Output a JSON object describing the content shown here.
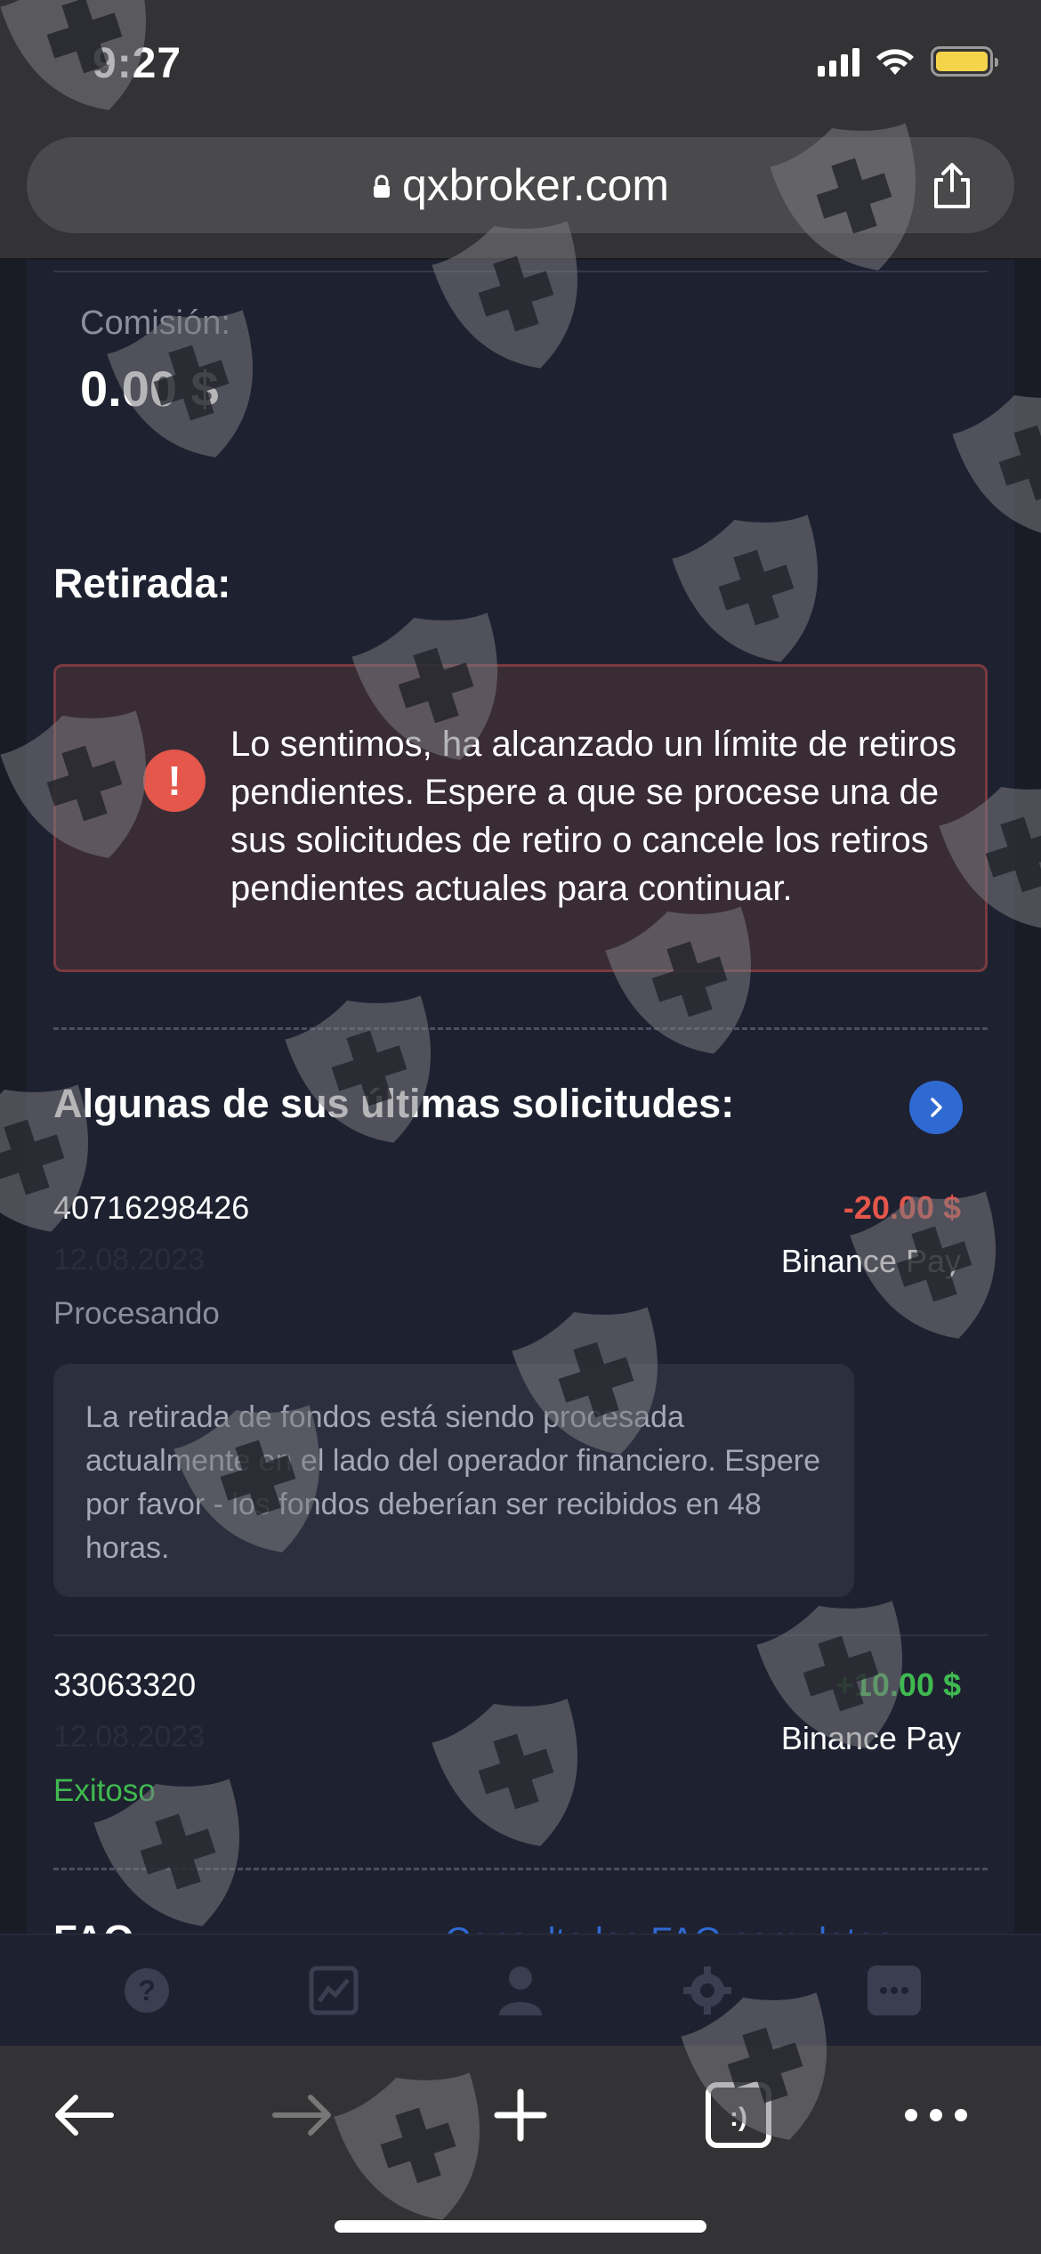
{
  "status_bar": {
    "time": "9:27"
  },
  "browser": {
    "url": "qxbroker.com"
  },
  "commission": {
    "label": "Comisión:",
    "value": "0.00 $"
  },
  "withdrawal": {
    "title": "Retirada:",
    "alert_message": "Lo sentimos, ha alcanzado un límite de retiros pendientes. Espere a que se procese una de sus solicitudes de retiro o cancele los retiros pendientes actuales para continuar."
  },
  "requests": {
    "title": "Algunas de sus últimas solicitudes:",
    "items": [
      {
        "id": "40716298426",
        "date": "12.08.2023",
        "status": "Procesando",
        "amount": "-20.00 $",
        "method": "Binance Pay",
        "note": "La retirada de fondos está siendo procesada actualmente en el lado del operador financiero. Espere por favor - los fondos deberían ser recibidos en 48 horas."
      },
      {
        "id": "33063320",
        "date": "12.08.2023",
        "status": "Exitoso",
        "amount": "+10.00 $",
        "method": "Binance Pay"
      }
    ]
  },
  "faq": {
    "title": "FAQ",
    "link": "Consulte las FAQ completas"
  },
  "colors": {
    "negative": "#e5564b",
    "positive": "#3fb950",
    "accent": "#2f6ad2",
    "background": "#1e2130"
  },
  "site_nav": [
    "help-icon",
    "chart-icon",
    "user-icon",
    "settings-icon",
    "chat-icon"
  ],
  "browser_toolbar": [
    "back-icon",
    "forward-icon",
    "new-tab-icon",
    "tabs-icon",
    "more-icon"
  ]
}
